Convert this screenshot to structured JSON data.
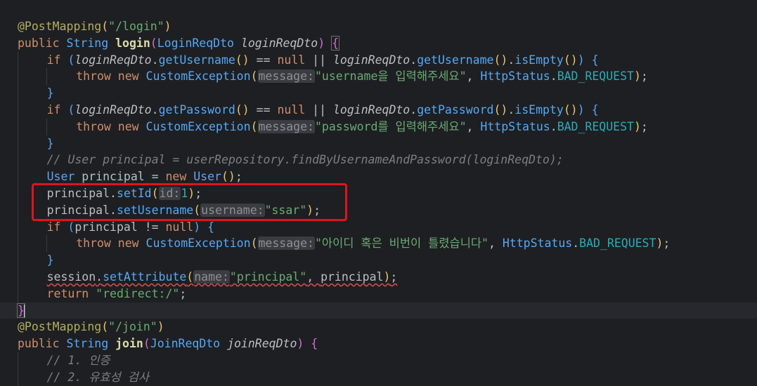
{
  "lines": [
    {
      "ann": "@PostMapping",
      "p1": "(",
      "str": "\"/login\"",
      "p2": ")"
    },
    {
      "kw": "public",
      "type": "String",
      "fn": "login",
      "p1": "(",
      "cls": "LoginReqDto",
      "param": "loginReqDto",
      "p2": ")",
      "brace": "{"
    },
    {
      "kw": "if",
      "p1": "(",
      "param": "loginReqDto",
      "m1": "getUsername",
      "c1": "()",
      "eq": " == ",
      "nul": "null",
      "or": " || ",
      "param2": "loginReqDto",
      "m2": "getUsername",
      "c2": "()",
      "m3": "isEmpty",
      "c3": "()",
      "p2": ")",
      "brace": "{"
    },
    {
      "kw": "throw",
      "kw2": "new",
      "cls": "CustomException",
      "p1": "(",
      "hint": "message:",
      "str": "\"username을 입력해주세요\"",
      "cls2": "HttpStatus",
      "field": "BAD_REQUEST",
      "p2": ")",
      "end": ";"
    },
    {
      "brace": "}"
    },
    {
      "kw": "if",
      "p1": "(",
      "param": "loginReqDto",
      "m1": "getPassword",
      "c1": "()",
      "eq": " == ",
      "nul": "null",
      "or": " || ",
      "param2": "loginReqDto",
      "m2": "getPassword",
      "c2": "()",
      "m3": "isEmpty",
      "c3": "()",
      "p2": ")",
      "brace": "{"
    },
    {
      "kw": "throw",
      "kw2": "new",
      "cls": "CustomException",
      "p1": "(",
      "hint": "message:",
      "str": "\"password를 입력해주세요\"",
      "cls2": "HttpStatus",
      "field": "BAD_REQUEST",
      "p2": ")",
      "end": ";"
    },
    {
      "brace": "}"
    },
    {
      "comment": "// User principal = userRepository.findByUsernameAndPassword(loginReqDto);"
    },
    {
      "cls": "User",
      "var": "principal",
      "kw": "new",
      "cls2": "User",
      "call": "()"
    },
    {
      "var": "principal",
      "m": "setId",
      "hint": "id:",
      "num": "1"
    },
    {
      "var": "principal",
      "m": "setUsername",
      "hint": "username:",
      "str": "\"ssar\""
    },
    {
      "kw": "if",
      "var": "principal",
      "op": "!=",
      "nul": "null",
      "brace": "{"
    },
    {
      "kw": "throw",
      "kw2": "new",
      "cls": "CustomException",
      "p1": "(",
      "hint": "message:",
      "str": "\"아이디 혹은 비번이 틀렸습니다\"",
      "cls2": "HttpStatus",
      "field": "BAD_REQUEST",
      "p2": ")",
      "end": ";"
    },
    {
      "brace": "}"
    },
    {
      "var": "session",
      "m": "setAttribute",
      "hint": "name:",
      "str": "\"principal\"",
      "var2": "principal"
    },
    {
      "kw": "return",
      "str": "\"redirect:/\""
    },
    {
      "brace": "}"
    },
    {
      "ann": "@PostMapping",
      "p1": "(",
      "str": "\"/join\"",
      "p2": ")"
    },
    {
      "kw": "public",
      "type": "String",
      "fn": "join",
      "p1": "(",
      "cls": "JoinReqDto",
      "param": "joinReqDto",
      "p2": ")",
      "brace": "{"
    },
    {
      "comment": "// 1. 인증"
    },
    {
      "comment": "// 2. 유효성 검사"
    }
  ]
}
